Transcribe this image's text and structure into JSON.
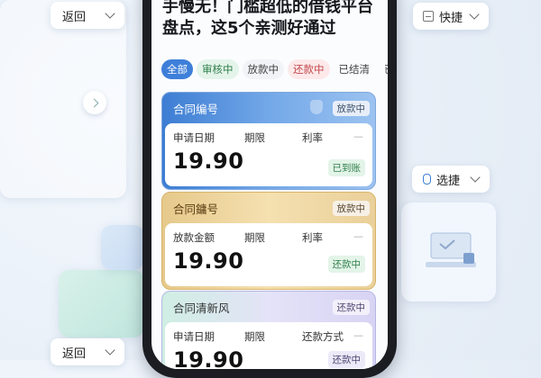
{
  "headline": {
    "line1": "手慢无！门槛超低的借钱平台",
    "line2": "盘点，这5个亲测好通过"
  },
  "floating": {
    "back_top": "返回",
    "back_bottom": "返回",
    "quick": "快捷",
    "select": "选捷"
  },
  "tabs": [
    "全部",
    "审核中",
    "放款中",
    "还款中",
    "已结清",
    "已逾期"
  ],
  "cards": [
    {
      "title": "合同编号",
      "head_badge": "放款中",
      "labels": [
        "申请日期",
        "期限",
        "利率"
      ],
      "amount": "19.90",
      "status": "已到账",
      "dash": "—"
    },
    {
      "title": "合同鏞号",
      "head_badge": "放款中",
      "labels": [
        "放款金额",
        "期限",
        "利率"
      ],
      "amount": "19.90",
      "status": "还款中",
      "dash": "—"
    },
    {
      "title": "合同清新风",
      "head_badge": "还款中",
      "labels": [
        "申请日期",
        "期限",
        "还款方式"
      ],
      "amount": "19.90",
      "status": "还款中",
      "dash": "—"
    }
  ],
  "colors": {
    "accent": "#3e7fd9",
    "green": "#2f7f4b"
  }
}
